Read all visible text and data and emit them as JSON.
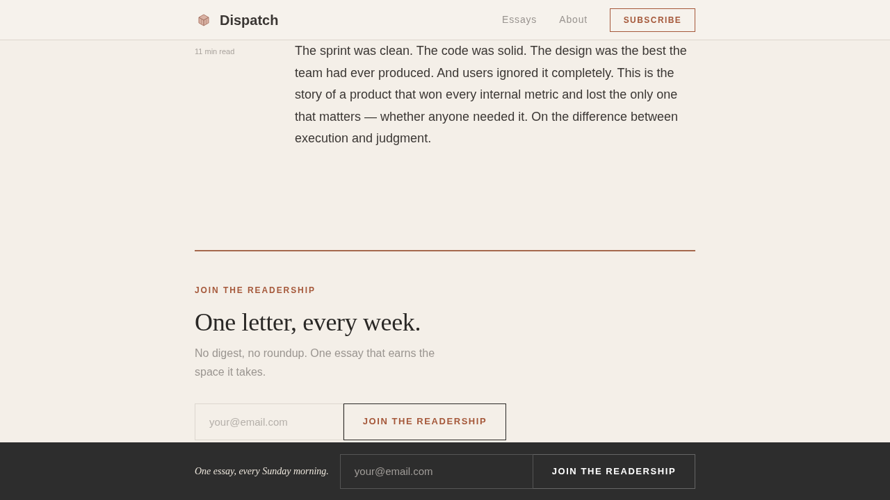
{
  "header": {
    "logo": "Dispatch",
    "nav": [
      {
        "label": "Essays"
      },
      {
        "label": "About"
      }
    ],
    "subscribe_button": "SUBSCRIBE"
  },
  "article": {
    "meta": "11 min read",
    "body": "The sprint was clean. The code was solid. The design was the best the team had ever produced. And users ignored it completely. This is the story of a product that won every internal metric and lost the only one that matters — whether anyone needed it. On the difference between execution and judgment."
  },
  "newsletter": {
    "eyebrow": "JOIN THE READERSHIP",
    "title": "One letter, every week.",
    "description": "No digest, no roundup. One essay that earns the space it takes.",
    "email_field": {
      "placeholder": "your@email.com"
    },
    "button": "JOIN THE READERSHIP"
  },
  "sticky_bar": {
    "tagline": "One essay, every Sunday morning.",
    "email_field": {
      "placeholder": "your@email.com"
    },
    "button": "JOIN THE READERSHIP"
  }
}
